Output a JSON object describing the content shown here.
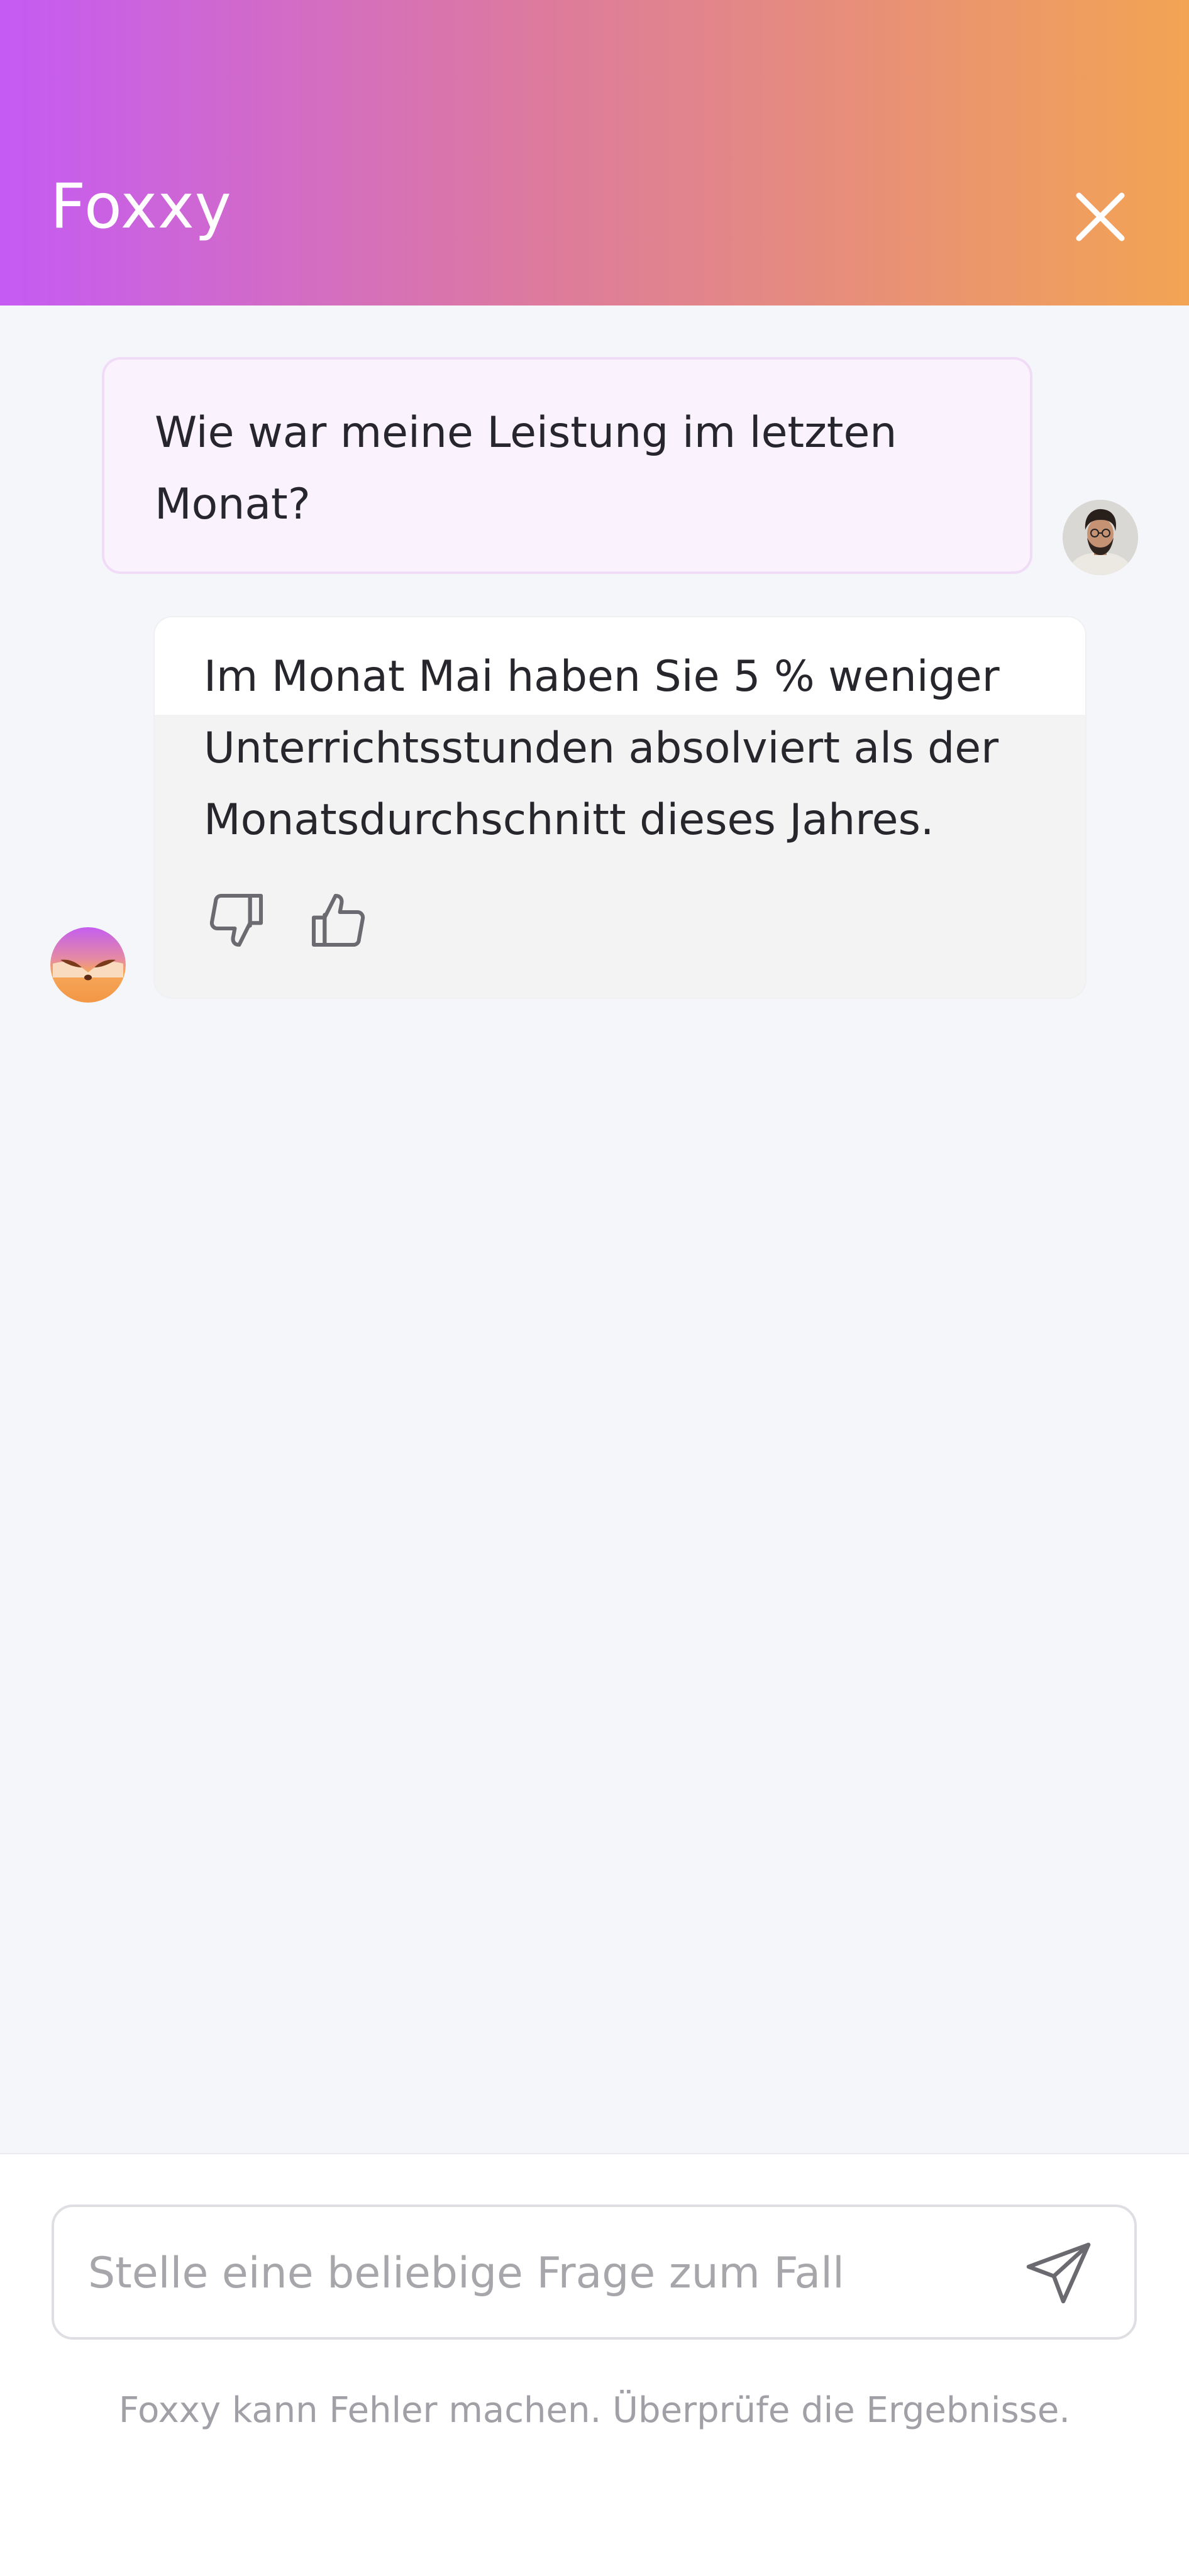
{
  "header": {
    "title": "Foxxy",
    "close_icon": "close-icon",
    "gradient": [
      "#c55bf3",
      "#dd7a9e",
      "#f3a453"
    ]
  },
  "messages": [
    {
      "role": "user",
      "text": "Wie war meine Leistung im letzten Monat?",
      "avatar_icon": "user-avatar"
    },
    {
      "role": "assistant",
      "text": "Im Monat Mai haben Sie 5 % weniger Unterrichtsstunden absolviert als der Monatsdurchschnitt dieses Jahres.",
      "avatar_icon": "fox-avatar",
      "feedback_icons": [
        "thumbs-down-icon",
        "thumbs-up-icon"
      ]
    }
  ],
  "composer": {
    "placeholder": "Stelle eine beliebige Frage zum Fall",
    "value": "",
    "send_icon": "send-icon"
  },
  "footer": {
    "disclaimer": "Foxxy kann Fehler machen. Überprüfe die Ergebnisse."
  },
  "colors": {
    "background": "#f5f6fa",
    "user_bubble": "#faf2fc",
    "user_bubble_border": "#f0dcf7",
    "bot_bubble": "#f3f3f3",
    "text": "#26262c",
    "muted_text": "#a0a0a6"
  }
}
